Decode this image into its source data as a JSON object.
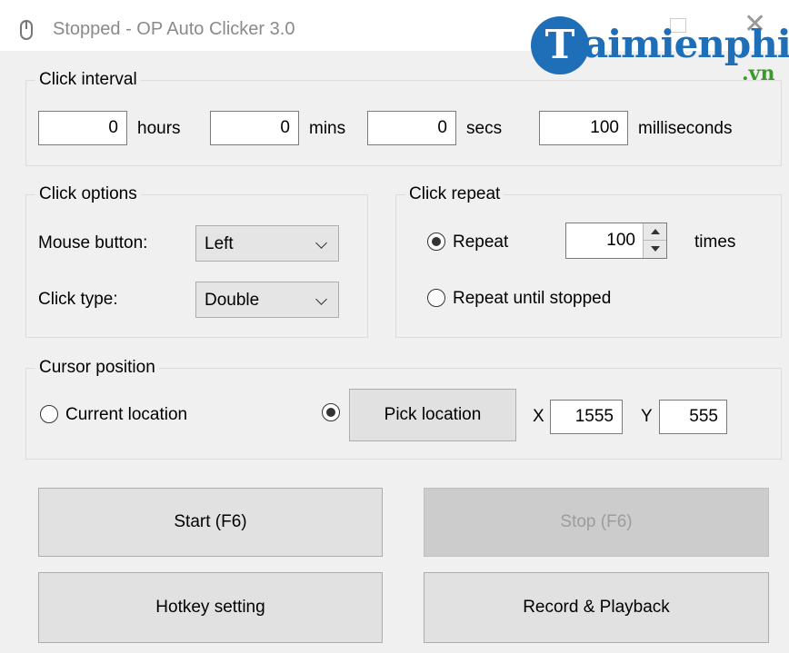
{
  "window": {
    "title": "Stopped - OP Auto Clicker 3.0",
    "icon": "mouse-icon",
    "close_glyph": "✕"
  },
  "watermark": {
    "brand": "aimienphi",
    "logo_letter": "T",
    "suffix": ".vn",
    "brand_color": "#1f6fb8",
    "suffix_color": "#3a9a2a"
  },
  "click_interval": {
    "legend": "Click interval",
    "hours": {
      "value": "0",
      "label": "hours"
    },
    "mins": {
      "value": "0",
      "label": "mins"
    },
    "secs": {
      "value": "0",
      "label": "secs"
    },
    "milliseconds": {
      "value": "100",
      "label": "milliseconds"
    }
  },
  "click_options": {
    "legend": "Click options",
    "mouse_button_label": "Mouse button:",
    "mouse_button_value": "Left",
    "click_type_label": "Click type:",
    "click_type_value": "Double"
  },
  "click_repeat": {
    "legend": "Click repeat",
    "repeat_label": "Repeat",
    "repeat_selected": true,
    "repeat_count": "100",
    "times_label": "times",
    "until_stopped_label": "Repeat until stopped"
  },
  "cursor_position": {
    "legend": "Cursor position",
    "current_location_label": "Current location",
    "pick_location_label": "Pick location",
    "pick_selected": true,
    "x_label": "X",
    "x_value": "1555",
    "y_label": "Y",
    "y_value": "555"
  },
  "buttons": {
    "start": "Start (F6)",
    "stop": "Stop (F6)",
    "hotkey": "Hotkey setting",
    "record": "Record & Playback"
  }
}
